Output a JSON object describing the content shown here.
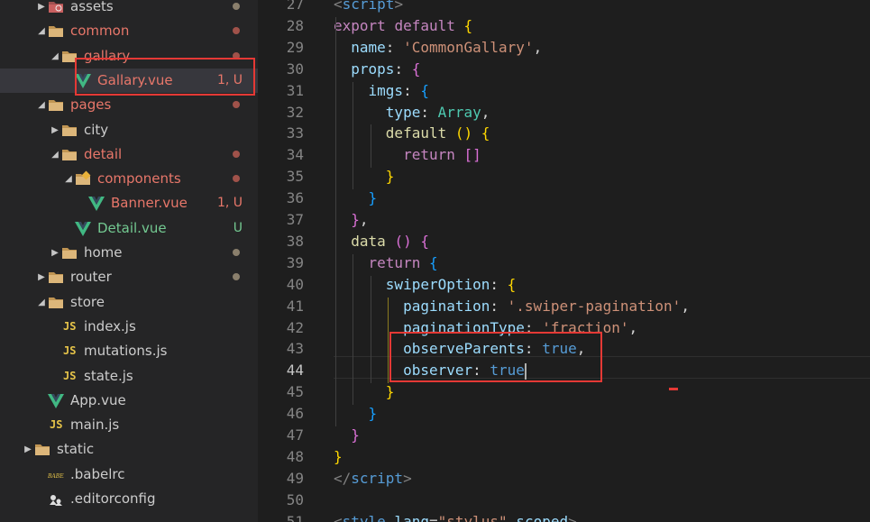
{
  "explorer": {
    "items": [
      {
        "label": "assets",
        "icon": "folder-assets-icon",
        "type": "folder",
        "status": "",
        "dot": true,
        "color": "#cccccc"
      },
      {
        "label": "common",
        "icon": "folder-icon",
        "type": "folder",
        "status": "",
        "dot": true,
        "color": "#e8776a"
      },
      {
        "label": "gallary",
        "icon": "folder-icon",
        "type": "folder",
        "status": "",
        "dot": true,
        "color": "#e8776a"
      },
      {
        "label": "Gallary.vue",
        "icon": "vue-icon",
        "type": "file",
        "status": "1, U",
        "dot": false,
        "color": "#e8776a"
      },
      {
        "label": "pages",
        "icon": "folder-icon",
        "type": "folder",
        "status": "",
        "dot": true,
        "color": "#e8776a"
      },
      {
        "label": "city",
        "icon": "folder-icon",
        "type": "folder",
        "status": "",
        "dot": false,
        "color": "#cccccc"
      },
      {
        "label": "detail",
        "icon": "folder-icon",
        "type": "folder",
        "status": "",
        "dot": true,
        "color": "#e8776a"
      },
      {
        "label": "components",
        "icon": "folder-components-icon",
        "type": "folder",
        "status": "",
        "dot": true,
        "color": "#e8776a"
      },
      {
        "label": "Banner.vue",
        "icon": "vue-icon",
        "type": "file",
        "status": "1, U",
        "dot": false,
        "color": "#e8776a"
      },
      {
        "label": "Detail.vue",
        "icon": "vue-icon",
        "type": "file",
        "status": "U",
        "dot": false,
        "color": "#73c991"
      },
      {
        "label": "home",
        "icon": "folder-icon",
        "type": "folder",
        "status": "",
        "dot": true,
        "color": "#cccccc"
      },
      {
        "label": "router",
        "icon": "folder-icon",
        "type": "folder",
        "status": "",
        "dot": true,
        "color": "#cccccc"
      },
      {
        "label": "store",
        "icon": "folder-icon",
        "type": "folder",
        "status": "",
        "dot": false,
        "color": "#cccccc"
      },
      {
        "label": "index.js",
        "icon": "js-icon",
        "type": "file",
        "status": "",
        "dot": false,
        "color": "#cccccc"
      },
      {
        "label": "mutations.js",
        "icon": "js-icon",
        "type": "file",
        "status": "",
        "dot": false,
        "color": "#cccccc"
      },
      {
        "label": "state.js",
        "icon": "js-icon",
        "type": "file",
        "status": "",
        "dot": false,
        "color": "#cccccc"
      },
      {
        "label": "App.vue",
        "icon": "vue-icon",
        "type": "file",
        "status": "",
        "dot": false,
        "color": "#cccccc"
      },
      {
        "label": "main.js",
        "icon": "js-icon",
        "type": "file",
        "status": "",
        "dot": false,
        "color": "#cccccc"
      },
      {
        "label": "static",
        "icon": "folder-icon",
        "type": "folder",
        "status": "",
        "dot": false,
        "color": "#cccccc"
      },
      {
        "label": ".babelrc",
        "icon": "babel-icon",
        "type": "file",
        "status": "",
        "dot": false,
        "color": "#cccccc"
      },
      {
        "label": ".editorconfig",
        "icon": "editorconfig-icon",
        "type": "file",
        "status": "",
        "dot": false,
        "color": "#cccccc"
      }
    ]
  },
  "editor": {
    "current_line": 44,
    "lines": [
      {
        "num": "27",
        "tokens": [
          {
            "t": "<",
            "c": "g"
          },
          {
            "t": "script",
            "c": "n"
          },
          {
            "t": ">",
            "c": "g"
          }
        ]
      },
      {
        "num": "28",
        "tokens": [
          {
            "t": "export",
            "c": "k"
          },
          {
            "t": " "
          },
          {
            "t": "default",
            "c": "k"
          },
          {
            "t": " "
          },
          {
            "t": "{",
            "c": "y"
          }
        ]
      },
      {
        "num": "29",
        "tokens": [
          {
            "t": "  "
          },
          {
            "t": "name",
            "c": "p"
          },
          {
            "t": ": "
          },
          {
            "t": "'CommonGallary'",
            "c": "s"
          },
          {
            "t": ","
          }
        ]
      },
      {
        "num": "30",
        "tokens": [
          {
            "t": "  "
          },
          {
            "t": "props",
            "c": "p"
          },
          {
            "t": ": "
          },
          {
            "t": "{",
            "c": "m"
          }
        ]
      },
      {
        "num": "31",
        "tokens": [
          {
            "t": "    "
          },
          {
            "t": "imgs",
            "c": "p"
          },
          {
            "t": ": "
          },
          {
            "t": "{",
            "c": "b"
          }
        ]
      },
      {
        "num": "32",
        "tokens": [
          {
            "t": "      "
          },
          {
            "t": "type",
            "c": "p"
          },
          {
            "t": ": "
          },
          {
            "t": "Array",
            "c": "t"
          },
          {
            "t": ","
          }
        ]
      },
      {
        "num": "33",
        "tokens": [
          {
            "t": "      "
          },
          {
            "t": "default",
            "c": "f"
          },
          {
            "t": " "
          },
          {
            "t": "()",
            "c": "y"
          },
          {
            "t": " "
          },
          {
            "t": "{",
            "c": "y"
          }
        ]
      },
      {
        "num": "34",
        "tokens": [
          {
            "t": "        "
          },
          {
            "t": "return",
            "c": "k"
          },
          {
            "t": " "
          },
          {
            "t": "[]",
            "c": "m"
          }
        ]
      },
      {
        "num": "35",
        "tokens": [
          {
            "t": "      "
          },
          {
            "t": "}",
            "c": "y"
          }
        ]
      },
      {
        "num": "36",
        "tokens": [
          {
            "t": "    "
          },
          {
            "t": "}",
            "c": "b"
          }
        ]
      },
      {
        "num": "37",
        "tokens": [
          {
            "t": "  "
          },
          {
            "t": "}",
            "c": "m"
          },
          {
            "t": ","
          }
        ]
      },
      {
        "num": "38",
        "tokens": [
          {
            "t": "  "
          },
          {
            "t": "data",
            "c": "f"
          },
          {
            "t": " "
          },
          {
            "t": "()",
            "c": "m"
          },
          {
            "t": " "
          },
          {
            "t": "{",
            "c": "m"
          }
        ]
      },
      {
        "num": "39",
        "tokens": [
          {
            "t": "    "
          },
          {
            "t": "return",
            "c": "k"
          },
          {
            "t": " "
          },
          {
            "t": "{",
            "c": "b"
          }
        ]
      },
      {
        "num": "40",
        "tokens": [
          {
            "t": "      "
          },
          {
            "t": "swiperOption",
            "c": "p"
          },
          {
            "t": ": "
          },
          {
            "t": "{",
            "c": "y"
          }
        ]
      },
      {
        "num": "41",
        "tokens": [
          {
            "t": "        "
          },
          {
            "t": "pagination",
            "c": "p"
          },
          {
            "t": ": "
          },
          {
            "t": "'.swiper-pagination'",
            "c": "s"
          },
          {
            "t": ","
          }
        ]
      },
      {
        "num": "42",
        "tokens": [
          {
            "t": "        "
          },
          {
            "t": "paginationType",
            "c": "p"
          },
          {
            "t": ": "
          },
          {
            "t": "'fraction'",
            "c": "s"
          },
          {
            "t": ","
          }
        ]
      },
      {
        "num": "43",
        "tokens": [
          {
            "t": "        "
          },
          {
            "t": "observeParents",
            "c": "p"
          },
          {
            "t": ": "
          },
          {
            "t": "true",
            "c": "n"
          },
          {
            "t": ","
          }
        ]
      },
      {
        "num": "44",
        "tokens": [
          {
            "t": "        "
          },
          {
            "t": "observer",
            "c": "p"
          },
          {
            "t": ": "
          },
          {
            "t": "true",
            "c": "n"
          }
        ]
      },
      {
        "num": "45",
        "tokens": [
          {
            "t": "      "
          },
          {
            "t": "}",
            "c": "y"
          }
        ]
      },
      {
        "num": "46",
        "tokens": [
          {
            "t": "    "
          },
          {
            "t": "}",
            "c": "b"
          }
        ]
      },
      {
        "num": "47",
        "tokens": [
          {
            "t": "  "
          },
          {
            "t": "}",
            "c": "m"
          }
        ]
      },
      {
        "num": "48",
        "tokens": [
          {
            "t": "}",
            "c": "y"
          }
        ]
      },
      {
        "num": "49",
        "tokens": [
          {
            "t": "</",
            "c": "g"
          },
          {
            "t": "script",
            "c": "n"
          },
          {
            "t": ">",
            "c": "g"
          }
        ]
      },
      {
        "num": "50",
        "tokens": []
      },
      {
        "num": "51",
        "tokens": [
          {
            "t": "<",
            "c": "g"
          },
          {
            "t": "style",
            "c": "n"
          },
          {
            "t": " "
          },
          {
            "t": "lang",
            "c": "p"
          },
          {
            "t": "="
          },
          {
            "t": "\"stylus\"",
            "c": "s"
          },
          {
            "t": " "
          },
          {
            "t": "scoped",
            "c": "p"
          },
          {
            "t": ">",
            "c": "g"
          }
        ]
      }
    ]
  }
}
